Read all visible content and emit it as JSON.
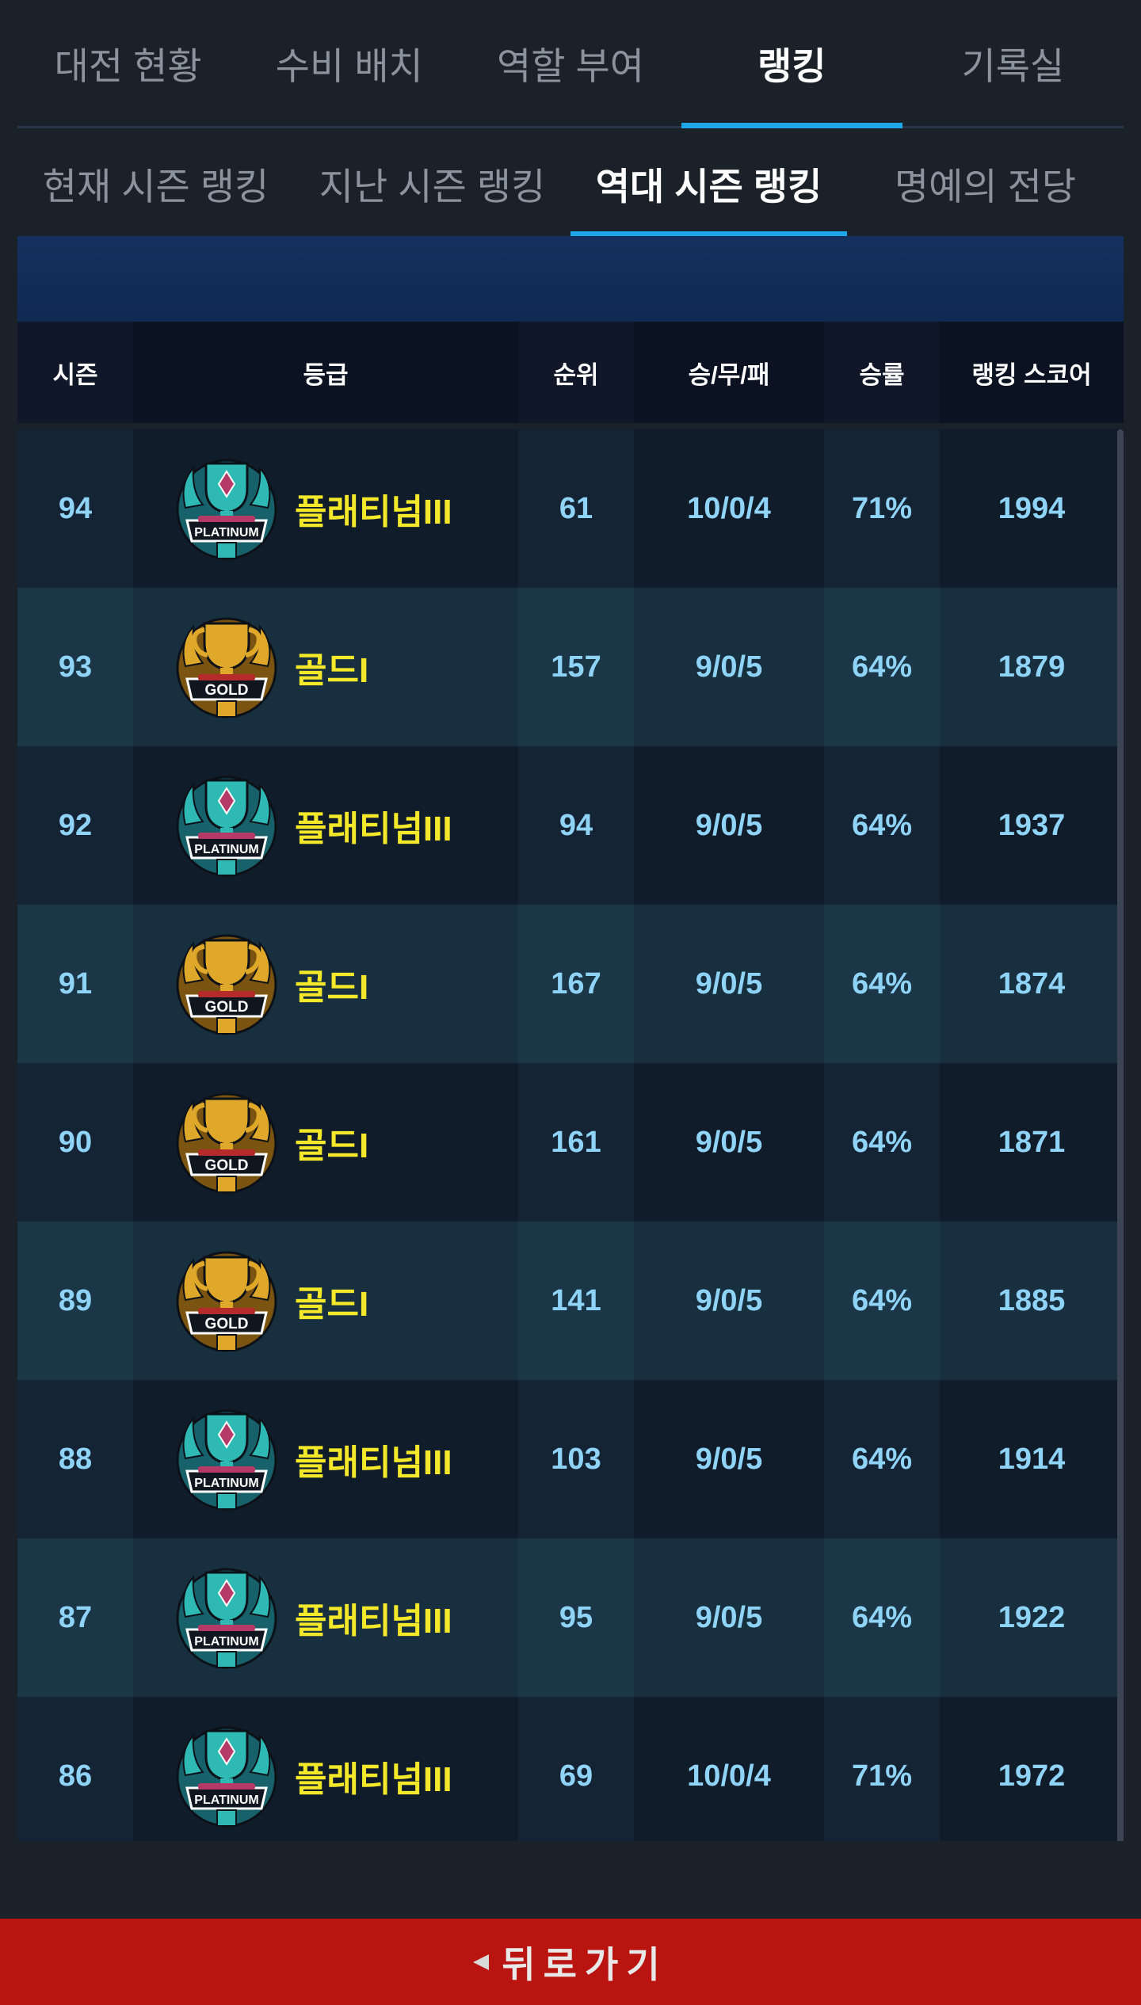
{
  "main_tabs": [
    {
      "label": "대전 현황",
      "active": false
    },
    {
      "label": "수비 배치",
      "active": false
    },
    {
      "label": "역할 부여",
      "active": false
    },
    {
      "label": "랭킹",
      "active": true
    },
    {
      "label": "기록실",
      "active": false
    }
  ],
  "sub_tabs": [
    {
      "label": "현재 시즌 랭킹",
      "active": false
    },
    {
      "label": "지난 시즌 랭킹",
      "active": false
    },
    {
      "label": "역대 시즌 랭킹",
      "active": true
    },
    {
      "label": "명예의 전당",
      "active": false
    }
  ],
  "table": {
    "headers": [
      "시즌",
      "등급",
      "순위",
      "승/무/패",
      "승률",
      "랭킹 스코어"
    ],
    "rows": [
      {
        "season": "94",
        "badge": "platinum",
        "grade": "플래티넘III",
        "rank": "61",
        "record": "10/0/4",
        "win_rate": "71%",
        "score": "1994"
      },
      {
        "season": "93",
        "badge": "gold",
        "grade": "골드I",
        "rank": "157",
        "record": "9/0/5",
        "win_rate": "64%",
        "score": "1879"
      },
      {
        "season": "92",
        "badge": "platinum",
        "grade": "플래티넘III",
        "rank": "94",
        "record": "9/0/5",
        "win_rate": "64%",
        "score": "1937"
      },
      {
        "season": "91",
        "badge": "gold",
        "grade": "골드I",
        "rank": "167",
        "record": "9/0/5",
        "win_rate": "64%",
        "score": "1874"
      },
      {
        "season": "90",
        "badge": "gold",
        "grade": "골드I",
        "rank": "161",
        "record": "9/0/5",
        "win_rate": "64%",
        "score": "1871"
      },
      {
        "season": "89",
        "badge": "gold",
        "grade": "골드I",
        "rank": "141",
        "record": "9/0/5",
        "win_rate": "64%",
        "score": "1885"
      },
      {
        "season": "88",
        "badge": "platinum",
        "grade": "플래티넘III",
        "rank": "103",
        "record": "9/0/5",
        "win_rate": "64%",
        "score": "1914"
      },
      {
        "season": "87",
        "badge": "platinum",
        "grade": "플래티넘III",
        "rank": "95",
        "record": "9/0/5",
        "win_rate": "64%",
        "score": "1922"
      },
      {
        "season": "86",
        "badge": "platinum",
        "grade": "플래티넘III",
        "rank": "69",
        "record": "10/0/4",
        "win_rate": "71%",
        "score": "1972"
      }
    ]
  },
  "badges": {
    "platinum": {
      "text": "PLATINUM",
      "primary": "#2fb9b4",
      "dark": "#17616a",
      "accent": "#b53a68"
    },
    "gold": {
      "text": "GOLD",
      "primary": "#e0a82a",
      "dark": "#7a5410",
      "accent": "#b52a2a"
    }
  },
  "footer": {
    "label": "뒤로가기"
  },
  "colors": {
    "accent": "#1ea7e8",
    "grade_text": "#f3e829",
    "value_text": "#8fd3f7",
    "footer_bg": "#ba1410"
  }
}
